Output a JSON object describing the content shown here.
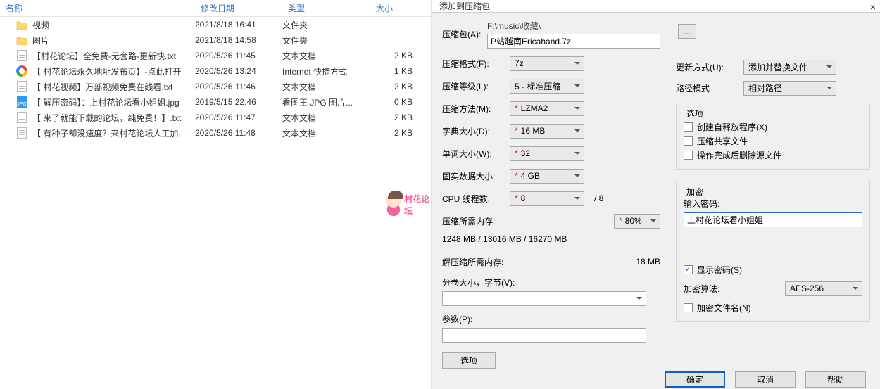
{
  "explorer": {
    "columns": {
      "name": "名称",
      "date": "修改日期",
      "type": "类型",
      "size": "大小"
    },
    "rows": [
      {
        "icon": "folder",
        "name": "视频",
        "date": "2021/8/18 16:41",
        "type": "文件夹",
        "size": ""
      },
      {
        "icon": "folder",
        "name": "图片",
        "date": "2021/8/18 14:58",
        "type": "文件夹",
        "size": ""
      },
      {
        "icon": "txt",
        "name": "【村花论坛】全免费-无套路-更新快.txt",
        "date": "2020/5/26 11:45",
        "type": "文本文档",
        "size": "2 KB"
      },
      {
        "icon": "html",
        "name": "【 村花论坛永久地址发布页】-点此打开",
        "date": "2020/5/26 13:24",
        "type": "Internet 快捷方式",
        "size": "1 KB"
      },
      {
        "icon": "txt",
        "name": "【 村花视频】万部视频免费在线看.txt",
        "date": "2020/5/26 11:46",
        "type": "文本文档",
        "size": "2 KB"
      },
      {
        "icon": "jpg",
        "name": "【 解压密码】：上村花论坛看小姐姐.jpg",
        "date": "2019/5/15 22:46",
        "type": "看图王 JPG 图片...",
        "size": "0 KB"
      },
      {
        "icon": "txt",
        "name": "【 来了就能下载的论坛，纯免费！】.txt",
        "date": "2020/5/26 11:47",
        "type": "文本文档",
        "size": "2 KB"
      },
      {
        "icon": "txt",
        "name": "【 有种子却没速度？来村花论坛人工加...",
        "date": "2020/5/26 11:48",
        "type": "文本文档",
        "size": "2 KB"
      }
    ]
  },
  "watermark": "村花论坛",
  "dialog": {
    "title": "添加到压缩包",
    "archive_label": "压缩包(A):",
    "path_line": "F:\\music\\收藏\\",
    "archive_file": "P站越南Ericahand.7z",
    "browse": "...",
    "format_label": "压缩格式(F):",
    "format_value": "7z",
    "level_label": "压缩等级(L):",
    "level_value": "5 - 标准压缩",
    "method_label": "压缩方法(M):",
    "method_value": "LZMA2",
    "dict_label": "字典大小(D):",
    "dict_value": "16 MB",
    "word_label": "单词大小(W):",
    "word_value": "32",
    "solid_label": "固实数据大小:",
    "solid_value": "4 GB",
    "threads_label": "CPU 线程数:",
    "threads_value": "8",
    "threads_total": "/ 8",
    "mem_compress_label": "压缩所需内存:",
    "mem_compress_value": "1248 MB / 13016 MB / 16270 MB",
    "mem_pct": "80%",
    "mem_decompress_label": "解压缩所需内存:",
    "mem_decompress_value": "18 MB",
    "split_label": "分卷大小，字节(V):",
    "params_label": "参数(P):",
    "options_btn": "选项",
    "update_label": "更新方式(U):",
    "update_value": "添加并替换文件",
    "pathmode_label": "路径模式",
    "pathmode_value": "相对路径",
    "options_group": "选项",
    "opt_sfx": "创建自释放程序(X)",
    "opt_shared": "压缩共享文件",
    "opt_delete": "操作完成后删除源文件",
    "encrypt_group": "加密",
    "pwd_label": "输入密码:",
    "pwd_value": "上村花论坛看小姐姐",
    "show_pwd": "显示密码(S)",
    "enc_method_label": "加密算法:",
    "enc_method_value": "AES-256",
    "enc_names": "加密文件名(N)",
    "ok": "确定",
    "cancel": "取消",
    "help": "帮助"
  }
}
